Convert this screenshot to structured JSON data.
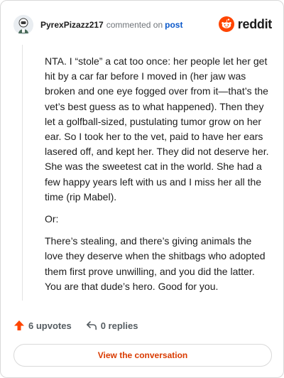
{
  "header": {
    "username": "PyrexPizazz217",
    "commented_text": "commented on",
    "post_link": "post",
    "brand": "reddit"
  },
  "comment": {
    "paragraphs": [
      "NTA. I “stole” a cat too once: her people let her get hit by a car far before I moved in (her jaw was broken and one eye fogged over from it—that’s the vet’s best guess as to what happened). Then they let a golfball-sized, pustulating tumor grow on her ear. So I took her to the vet, paid to have her ears lasered off, and kept her. They did not deserve her. She was the sweetest cat in the world. She had a few happy years left with us and I miss her all the time (rip Mabel).",
      "Or:",
      "There’s stealing, and there’s giving animals the love they deserve when the shitbags who adopted them first prove unwilling, and you did the latter. You are that dude’s hero. Good for you."
    ]
  },
  "actions": {
    "upvotes": "6 upvotes",
    "replies": "0 replies"
  },
  "footer": {
    "view_button": "View the conversation"
  },
  "colors": {
    "brand_orange": "#ff4500",
    "upvote_orange": "#ff4500",
    "link_blue": "#0a58ca",
    "button_text": "#d93a00"
  }
}
